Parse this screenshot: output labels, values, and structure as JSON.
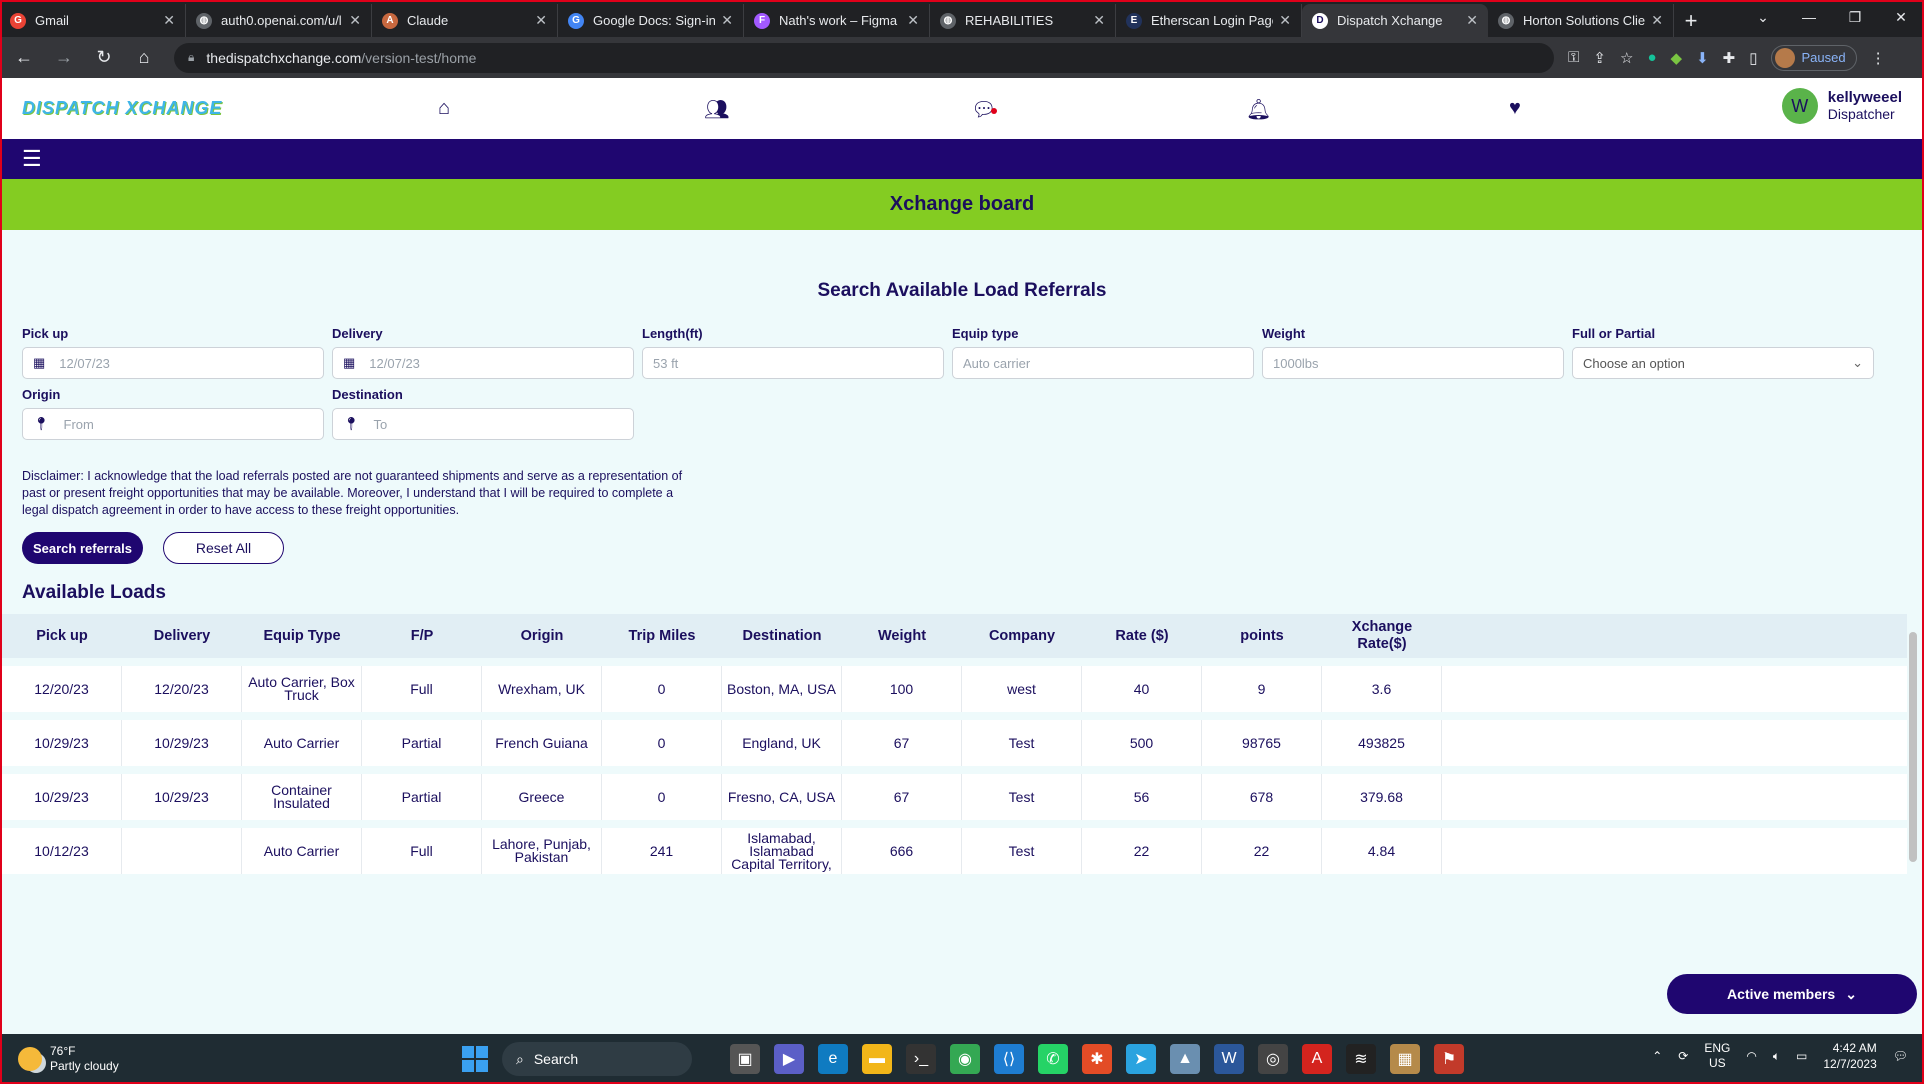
{
  "browser": {
    "tabs": [
      {
        "title": "Gmail",
        "color": "#ea4335",
        "glyph": "G"
      },
      {
        "title": "auth0.openai.com/u/l",
        "color": "#5f6368",
        "glyph": "◍"
      },
      {
        "title": "Claude",
        "color": "#c8683f",
        "glyph": "A"
      },
      {
        "title": "Google Docs: Sign-in",
        "color": "#4285f4",
        "glyph": "G"
      },
      {
        "title": "Nath's work – Figma",
        "color": "#a259ff",
        "glyph": "F"
      },
      {
        "title": "REHABILITIES",
        "color": "#5f6368",
        "glyph": "◍"
      },
      {
        "title": "Etherscan Login Page",
        "color": "#21325b",
        "glyph": "E"
      },
      {
        "title": "Dispatch Xchange",
        "color": "#ffffff",
        "glyph": "D",
        "active": true
      },
      {
        "title": "Horton Solutions Clie",
        "color": "#5f6368",
        "glyph": "◍"
      }
    ],
    "url_host": "thedispatchxchange.com",
    "url_path": "/version-test/home",
    "profile_label": "Paused"
  },
  "app": {
    "logo": "DISPATCH XCHANGE",
    "user": {
      "initial": "W",
      "name": "kellyweeel",
      "role": "Dispatcher"
    },
    "board_title": "Xchange board",
    "search_title": "Search Available Load Referrals",
    "fields": {
      "pickup": {
        "label": "Pick up",
        "placeholder": "12/07/23"
      },
      "delivery": {
        "label": "Delivery",
        "placeholder": "12/07/23"
      },
      "length": {
        "label": "Length(ft)",
        "placeholder": "53 ft"
      },
      "equip": {
        "label": "Equip type",
        "placeholder": "Auto carrier"
      },
      "weight": {
        "label": "Weight",
        "placeholder": "1000lbs"
      },
      "full_partial": {
        "label": "Full or Partial",
        "placeholder": "Choose an option"
      },
      "origin": {
        "label": "Origin",
        "placeholder": "From"
      },
      "destination": {
        "label": "Destination",
        "placeholder": "To"
      }
    },
    "disclaimer": "Disclaimer: I acknowledge that the load referrals posted are not guaranteed shipments and serve as a representation of past or present freight opportunities that may be available. Moreover, I understand that I will be required to complete a legal dispatch agreement in order to have access to these freight opportunities.",
    "search_button": "Search referrals",
    "reset_button": "Reset All",
    "available_title": "Available Loads",
    "table": {
      "headers": [
        "Pick up",
        "Delivery",
        "Equip Type",
        "F/P",
        "Origin",
        "Trip Miles",
        "Destination",
        "Weight",
        "Company",
        "Rate ($)",
        "points",
        "Xchange Rate($)"
      ],
      "rows": [
        [
          "12/20/23",
          "12/20/23",
          "Auto Carrier, Box Truck",
          "Full",
          "Wrexham, UK",
          "0",
          "Boston, MA, USA",
          "100",
          "west",
          "40",
          "9",
          "3.6"
        ],
        [
          "10/29/23",
          "10/29/23",
          "Auto Carrier",
          "Partial",
          "French Guiana",
          "0",
          "England, UK",
          "67",
          "Test",
          "500",
          "98765",
          "493825"
        ],
        [
          "10/29/23",
          "10/29/23",
          "Container Insulated",
          "Partial",
          "Greece",
          "0",
          "Fresno, CA, USA",
          "67",
          "Test",
          "56",
          "678",
          "379.68"
        ],
        [
          "10/12/23",
          "",
          "Auto Carrier",
          "Full",
          "Lahore, Punjab, Pakistan",
          "241",
          "Islamabad, Islamabad Capital Territory,",
          "666",
          "Test",
          "22",
          "22",
          "4.84"
        ]
      ]
    },
    "active_members": "Active members"
  },
  "taskbar": {
    "temp": "76°F",
    "weather": "Partly cloudy",
    "search": "Search",
    "lang1": "ENG",
    "lang2": "US",
    "time": "4:42 AM",
    "date": "12/7/2023"
  }
}
